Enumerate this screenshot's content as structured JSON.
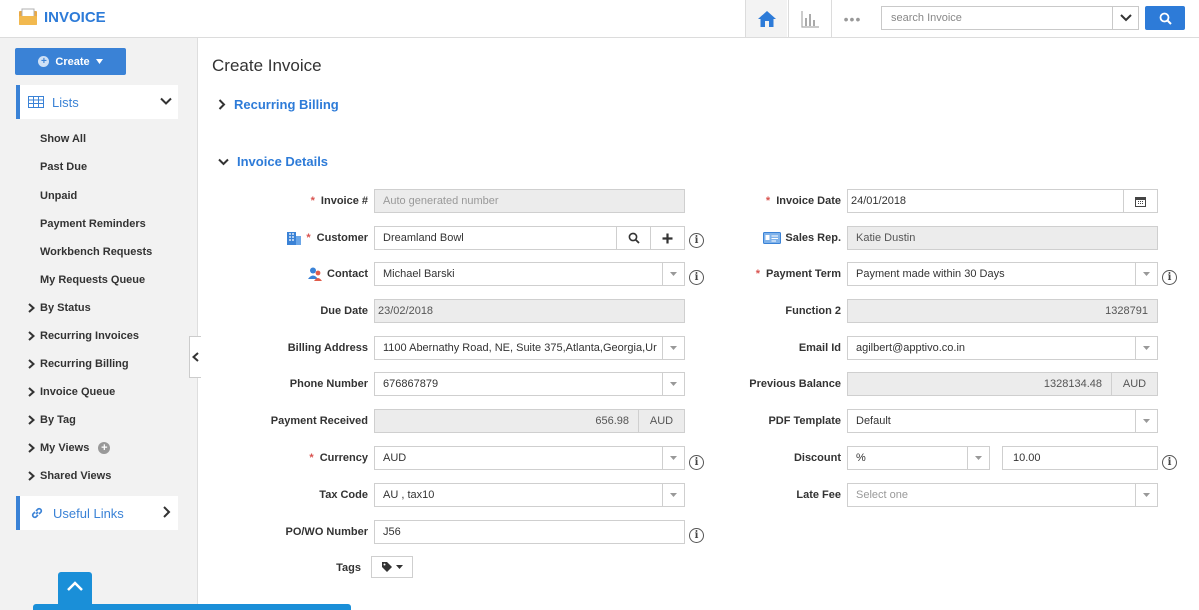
{
  "app": {
    "title": "INVOICE"
  },
  "topbar": {
    "icons": [
      "home-icon",
      "bar-chart-icon",
      "more-dots-icon"
    ],
    "dots": "•••",
    "search_placeholder": "search Invoice"
  },
  "sidebar": {
    "create_label": "Create",
    "lists_label": "Lists",
    "items": [
      "Show All",
      "Past Due",
      "Unpaid",
      "Payment Reminders",
      "Workbench Requests",
      "My Requests Queue"
    ],
    "groups": [
      "By Status",
      "Recurring Invoices",
      "Recurring Billing",
      "Invoice Queue",
      "By Tag",
      "My Views",
      "Shared Views"
    ],
    "useful_links_label": "Useful Links"
  },
  "main": {
    "title": "Create Invoice",
    "sections": {
      "recurring_billing": "Recurring Billing",
      "invoice_details": "Invoice Details"
    },
    "form": {
      "invoice_no": {
        "label": "Invoice #",
        "placeholder": "Auto generated number"
      },
      "customer": {
        "label": "Customer",
        "value": "Dreamland Bowl"
      },
      "contact": {
        "label": "Contact",
        "value": "Michael Barski"
      },
      "due_date": {
        "label": "Due Date",
        "value": "23/02/2018"
      },
      "billing_address": {
        "label": "Billing Address",
        "value": "1100 Abernathy Road, NE, Suite 375,Atlanta,Georgia,Ur"
      },
      "phone": {
        "label": "Phone Number",
        "value": "676867879"
      },
      "payment_received": {
        "label": "Payment Received",
        "value": "656.98",
        "unit": "AUD"
      },
      "currency": {
        "label": "Currency",
        "value": "AUD"
      },
      "tax_code": {
        "label": "Tax Code",
        "value": "AU , tax10"
      },
      "po_wo": {
        "label": "PO/WO Number",
        "value": "J56"
      },
      "tags": {
        "label": "Tags"
      },
      "invoice_date": {
        "label": "Invoice Date",
        "value": "24/01/2018"
      },
      "sales_rep": {
        "label": "Sales Rep.",
        "value": "Katie Dustin"
      },
      "payment_term": {
        "label": "Payment Term",
        "value": "Payment made within 30 Days"
      },
      "function2": {
        "label": "Function 2",
        "value": "1328791"
      },
      "email": {
        "label": "Email Id",
        "value": "agilbert@apptivo.co.in"
      },
      "previous_balance": {
        "label": "Previous Balance",
        "value": "1328134.48",
        "unit": "AUD"
      },
      "pdf_template": {
        "label": "PDF Template",
        "value": "Default"
      },
      "discount": {
        "label": "Discount",
        "type": "%",
        "value": "10.00"
      },
      "late_fee": {
        "label": "Late Fee",
        "placeholder": "Select one"
      }
    }
  },
  "colors": {
    "accent": "#2d7bd8",
    "required": "#d9534f",
    "sidebar_bg": "#f2f2f2",
    "readonly_bg": "#ececec"
  }
}
